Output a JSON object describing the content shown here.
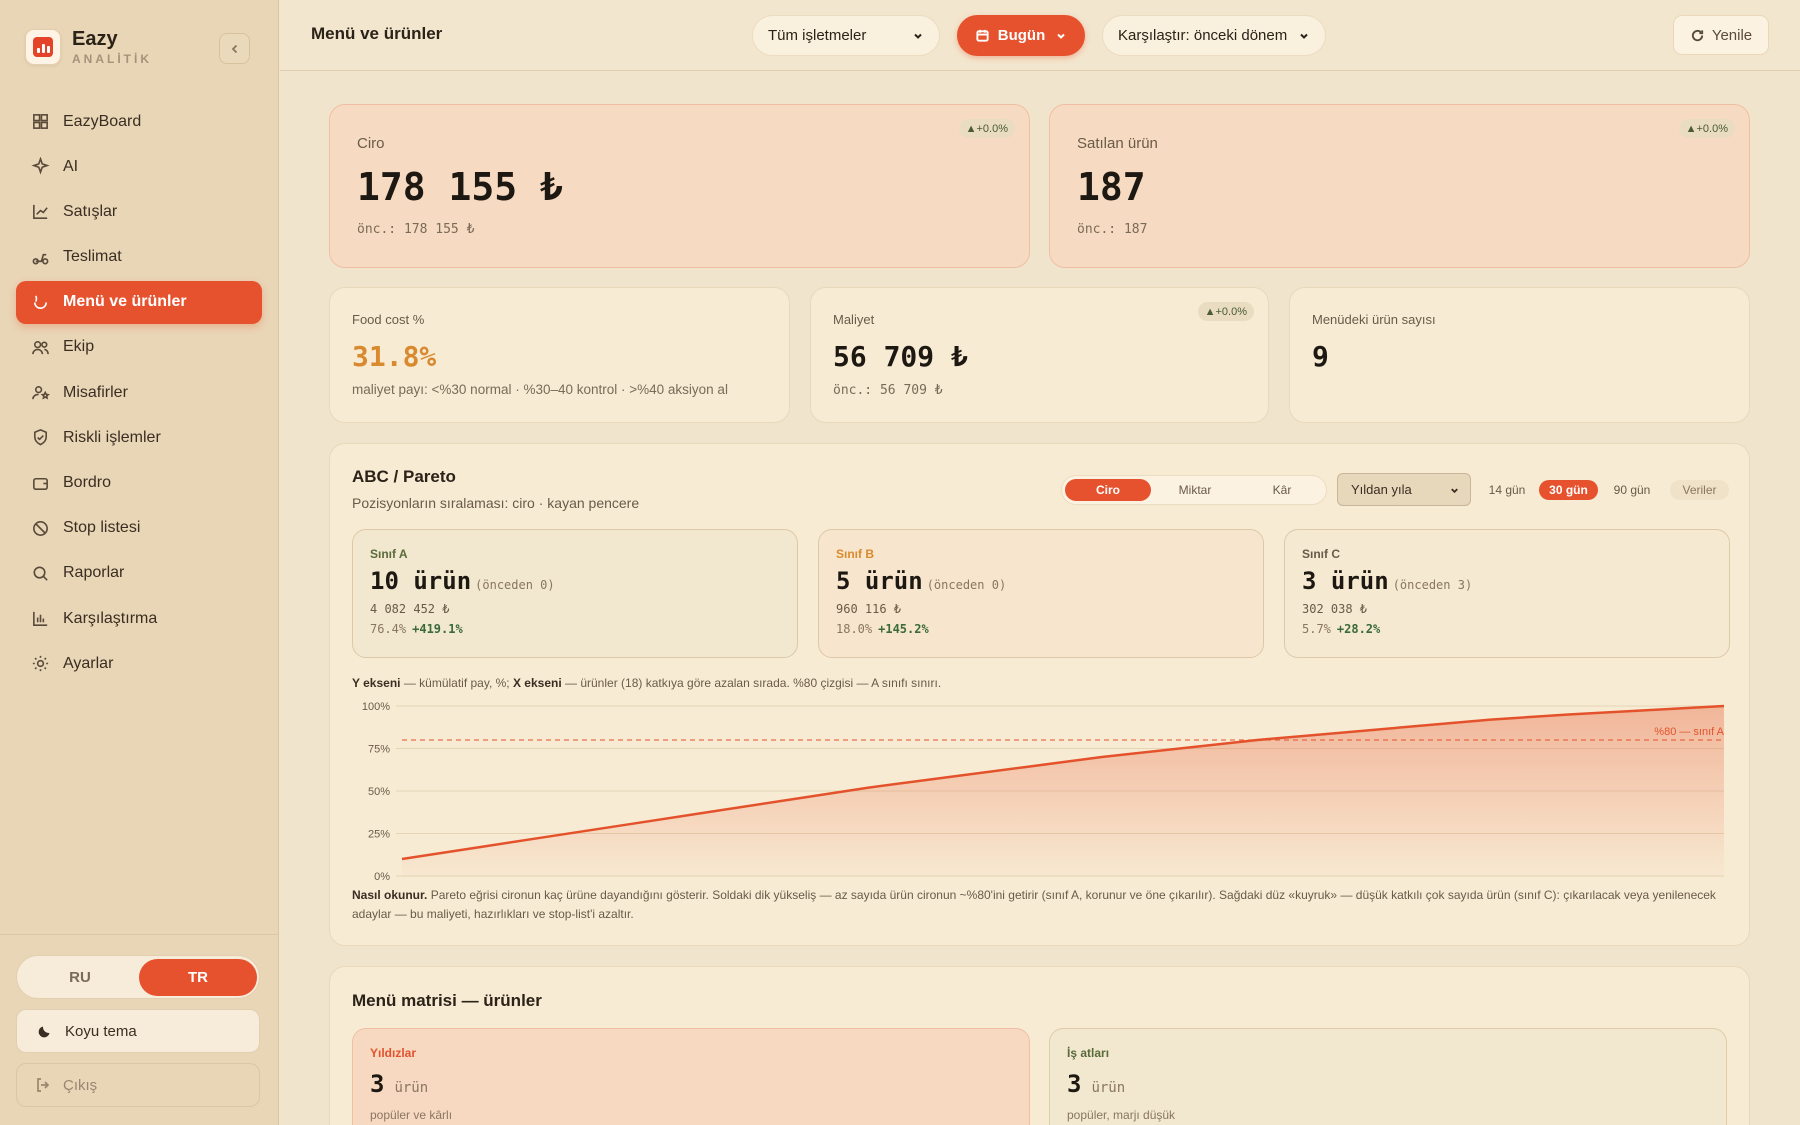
{
  "app": {
    "name": "Eazy",
    "subtitle": "ANALİTİK"
  },
  "nav": [
    {
      "label": "EazyBoard",
      "icon": "grid-icon"
    },
    {
      "label": "AI",
      "icon": "sparkle-icon"
    },
    {
      "label": "Satışlar",
      "icon": "chart-line-icon"
    },
    {
      "label": "Teslimat",
      "icon": "scooter-icon"
    },
    {
      "label": "Menü ve ürünler",
      "icon": "food-icon",
      "active": true
    },
    {
      "label": "Ekip",
      "icon": "users-icon"
    },
    {
      "label": "Misafirler",
      "icon": "user-star-icon"
    },
    {
      "label": "Riskli işlemler",
      "icon": "shield-icon"
    },
    {
      "label": "Bordro",
      "icon": "wallet-icon"
    },
    {
      "label": "Stop listesi",
      "icon": "ban-icon"
    },
    {
      "label": "Raporlar",
      "icon": "search-icon"
    },
    {
      "label": "Karşılaştırma",
      "icon": "bar-chart-icon"
    },
    {
      "label": "Ayarlar",
      "icon": "sun-gear-icon"
    }
  ],
  "sidebar_bottom": {
    "lang_ru": "RU",
    "lang_tr": "TR",
    "theme": "Koyu tema",
    "logout": "Çıkış"
  },
  "header": {
    "title": "Menü ve ürünler",
    "venue": "Tüm işletmeler",
    "period": "Bugün",
    "compare": "Karşılaştır: önceki dönem",
    "refresh": "Yenile"
  },
  "kpis": {
    "revenue": {
      "label": "Ciro",
      "value": "178 155 ₺",
      "prev": "önc.: 178 155 ₺",
      "delta": "▲+0.0%"
    },
    "sold": {
      "label": "Satılan ürün",
      "value": "187",
      "prev": "önc.: 187",
      "delta": "▲+0.0%"
    },
    "foodcost": {
      "label": "Food cost %",
      "value": "31.8%",
      "note": "maliyet payı: <%30 normal · %30–40 kontrol · >%40 aksiyon al"
    },
    "cost": {
      "label": "Maliyet",
      "value": "56 709 ₺",
      "prev": "önc.: 56 709 ₺",
      "delta": "▲+0.0%"
    },
    "menu_count": {
      "label": "Menüdeki ürün sayısı",
      "value": "9"
    }
  },
  "abc": {
    "title": "ABC / Pareto",
    "subtitle": "Pozisyonların sıralaması: ciro · kayan pencere",
    "tabs": [
      "Ciro",
      "Miktar",
      "Kâr"
    ],
    "compare_select": "Yıldan yıla",
    "ranges": [
      "14 gün",
      "30 gün",
      "90 gün"
    ],
    "data_btn": "Veriler",
    "classes": [
      {
        "title": "Sınıf A",
        "count": "10",
        "unit": "ürün",
        "prev": "(önceden 0)",
        "amount": "4 082 452 ₺",
        "share": "76.4%",
        "change": "+419.1%",
        "color": "#5a6a3a"
      },
      {
        "title": "Sınıf B",
        "count": "5",
        "unit": "ürün",
        "prev": "(önceden 0)",
        "amount": "960 116 ₺",
        "share": "18.0%",
        "change": "+145.2%",
        "color": "#d98a2e"
      },
      {
        "title": "Sınıf C",
        "count": "3",
        "unit": "ürün",
        "prev": "(önceden 3)",
        "amount": "302 038 ₺",
        "share": "5.7%",
        "change": "+28.2%",
        "color": "#6a5a48"
      }
    ],
    "axis_note_y": "Y ekseni",
    "axis_note_y_text": " — kümülatif pay, %; ",
    "axis_note_x": "X ekseni",
    "axis_note_x_text": " — ürünler (18) katkıya göre azalan sırada. %80 çizgisi — A sınıfı sınırı.",
    "how_to_label": "Nasıl okunur.",
    "how_to_text": " Pareto eğrisi cironun kaç ürüne dayandığını gösterir. Soldaki dik yükseliş — az sayıda ürün cironun ~%80'ini getirir (sınıf A, korunur ve öne çıkarılır). Sağdaki düz «kuyruk» — düşük katkılı çok sayıda ürün (sınıf C): çıkarılacak veya yenilenecek adaylar — bu maliyeti, hazırlıkları ve stop-list'i azaltır."
  },
  "chart_data": {
    "type": "area",
    "x": [
      1,
      2,
      3,
      4,
      5,
      6,
      7,
      8,
      9,
      10,
      11,
      12,
      13,
      14,
      15,
      16,
      17,
      18
    ],
    "values": [
      10,
      17,
      24,
      31,
      38,
      45,
      52,
      58,
      64,
      70,
      75,
      80,
      84,
      88,
      92,
      95,
      97.5,
      100
    ],
    "ylim": [
      0,
      100
    ],
    "yticks": [
      "0%",
      "25%",
      "50%",
      "75%",
      "100%"
    ],
    "threshold": 80,
    "threshold_label": "%80 — sınıf A",
    "line_color": "#e4522c"
  },
  "matrix": {
    "title": "Menü matrisi — ürünler",
    "cells": [
      {
        "title": "Yıldızlar",
        "count": "3",
        "unit": "ürün",
        "desc": "popüler ve kârlı"
      },
      {
        "title": "İş atları",
        "count": "3",
        "unit": "ürün",
        "desc": "popüler, marjı düşük"
      }
    ]
  }
}
